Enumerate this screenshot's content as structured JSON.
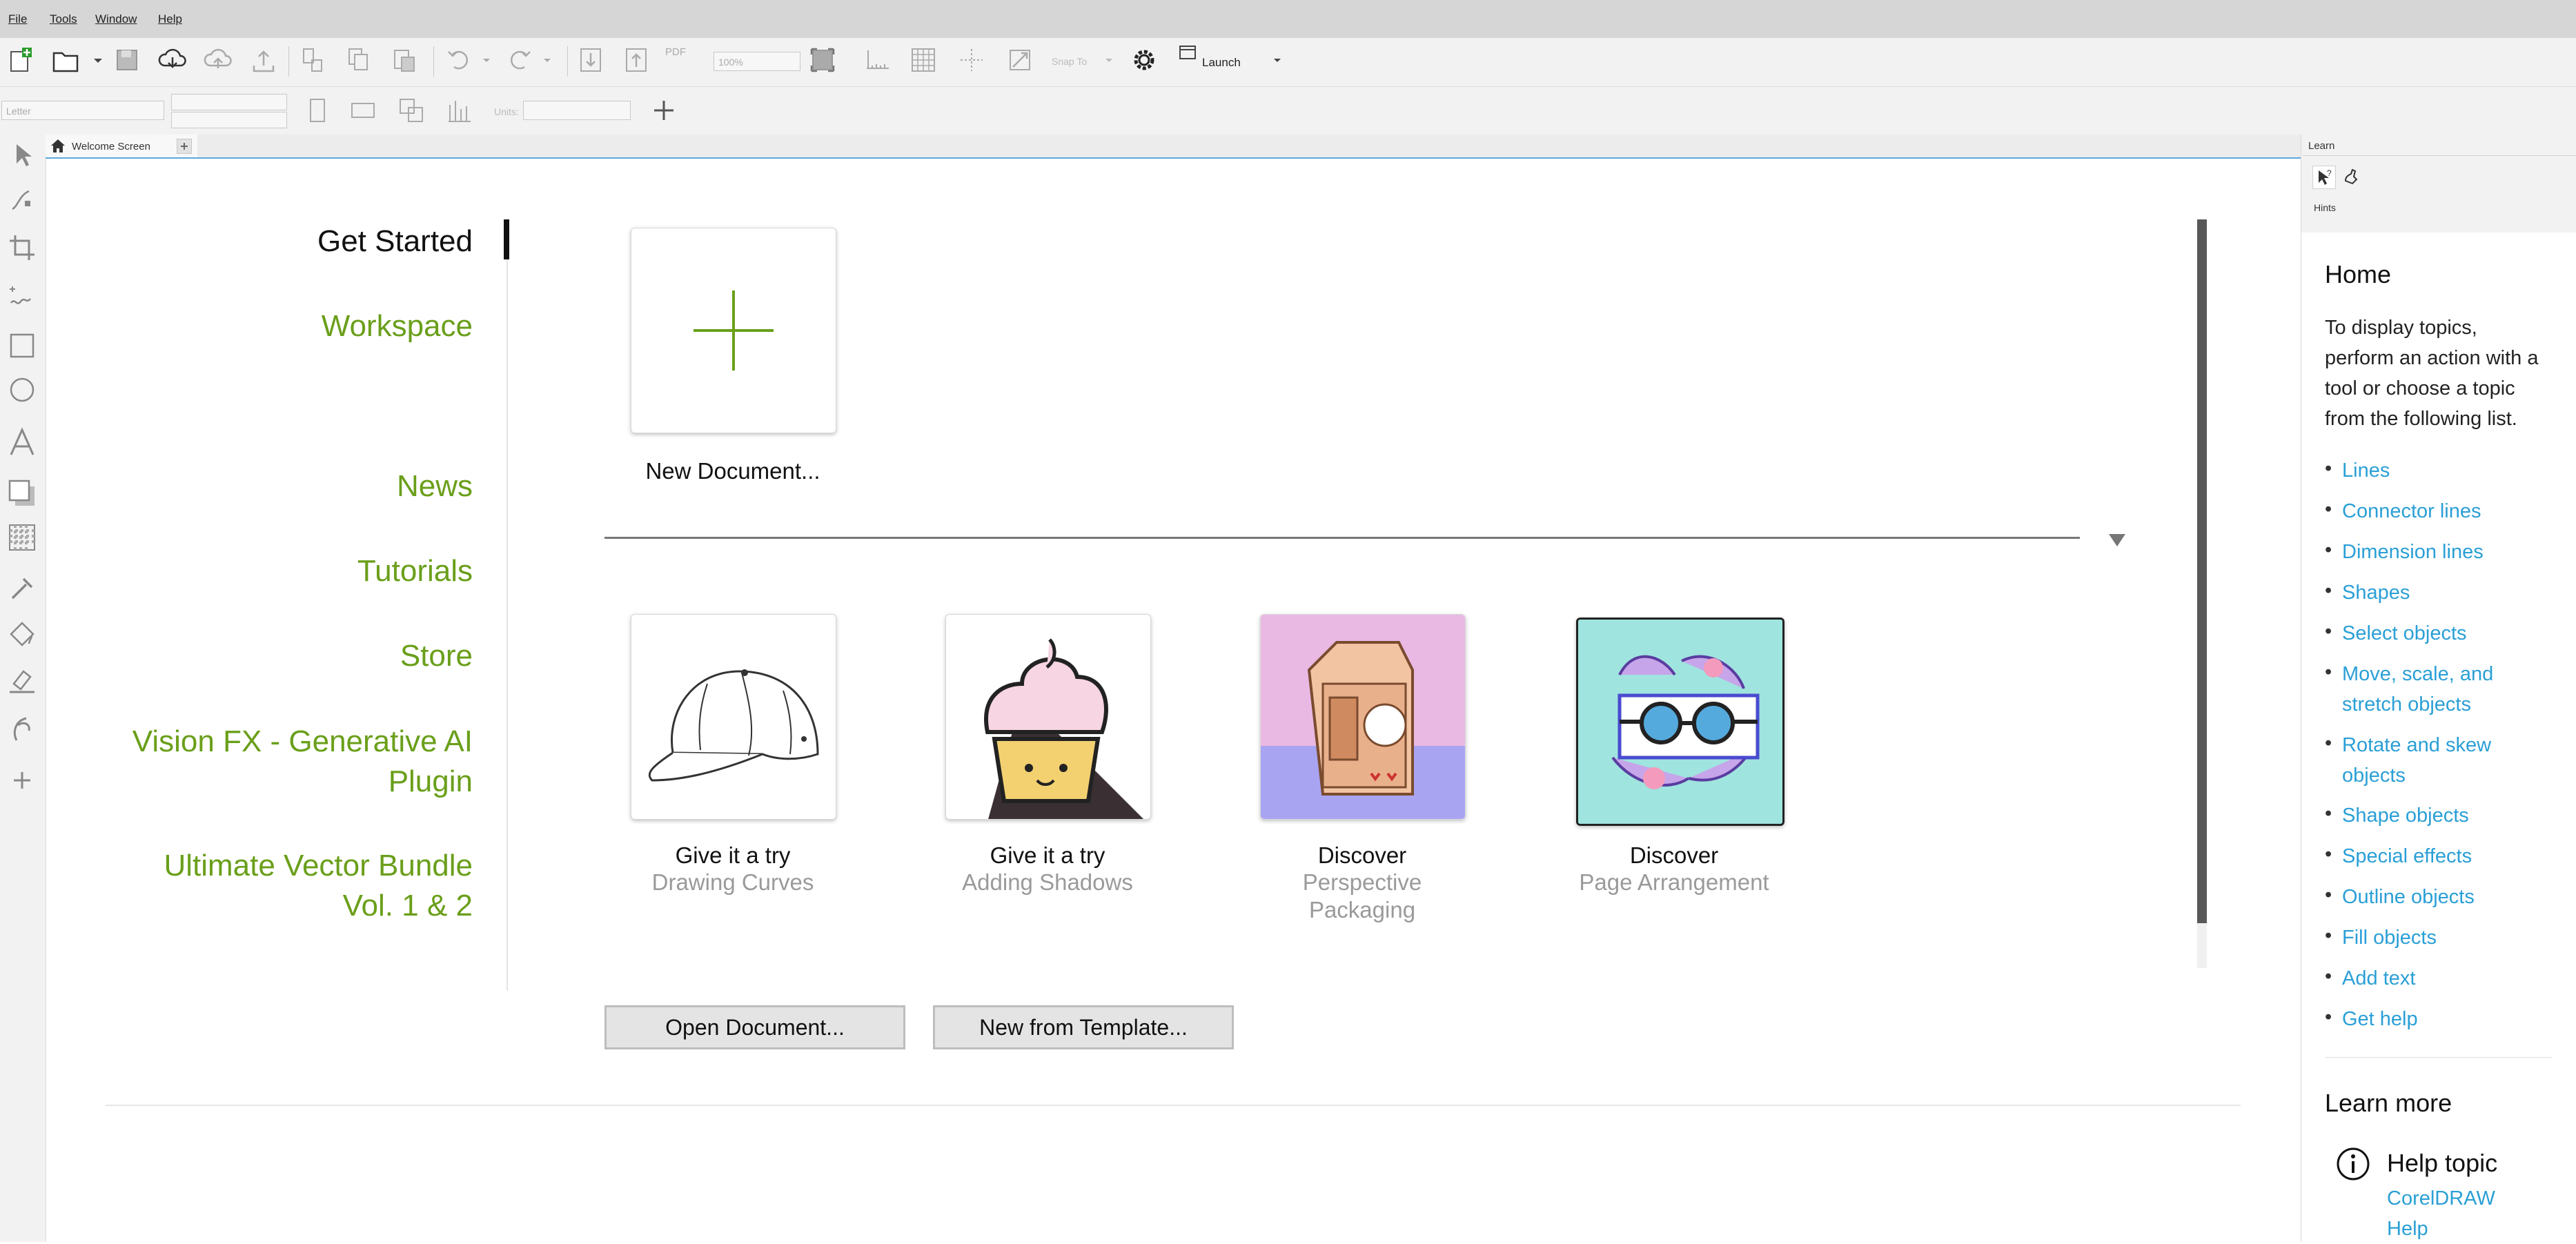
{
  "menubar": {
    "file": "File",
    "tools": "Tools",
    "window": "Window",
    "help": "Help"
  },
  "toolbar": {
    "zoom": "100%",
    "snap": "Snap To",
    "launch": "Launch",
    "pdf": "PDF"
  },
  "propbar": {
    "page_size": "Letter",
    "units": "Units:"
  },
  "tabs": {
    "welcome": "Welcome Screen"
  },
  "nav": {
    "get_started": "Get Started",
    "workspace": "Workspace",
    "news": "News",
    "tutorials": "Tutorials",
    "store": "Store",
    "vision_fx_1": "Vision FX - Generative AI",
    "vision_fx_2": "Plugin",
    "bundle_1": "Ultimate Vector Bundle",
    "bundle_2": "Vol. 1 & 2"
  },
  "new_document": "New Document...",
  "tiles": [
    {
      "title": "Give it a try",
      "subtitle": "Drawing Curves"
    },
    {
      "title": "Give it a try",
      "subtitle": "Adding Shadows"
    },
    {
      "title": "Discover",
      "subtitle_1": "Perspective",
      "subtitle_2": "Packaging"
    },
    {
      "title": "Discover",
      "subtitle": "Page Arrangement"
    }
  ],
  "buttons": {
    "open": "Open Document...",
    "template": "New from Template..."
  },
  "learn": {
    "panel_title": "Learn",
    "hints": "Hints",
    "home": "Home",
    "intro_1": "To display topics,",
    "intro_2": "perform an action with a",
    "intro_3": "tool or choose a topic",
    "intro_4": "from the following list.",
    "topics": [
      "Lines",
      "Connector lines",
      "Dimension lines",
      "Shapes",
      "Select objects",
      "Move, scale, and",
      "stretch objects",
      "Rotate and skew",
      "objects",
      "Shape objects",
      "Special effects",
      "Outline objects",
      "Fill objects",
      "Add text",
      "Get help"
    ],
    "learn_more": "Learn more",
    "help_topic": "Help topic",
    "help_link_1": "CorelDRAW",
    "help_link_2": "Help"
  },
  "colors": {
    "accent_green": "#6a9f1a",
    "link_blue": "#2a9fd6",
    "tab_line": "#5aa8e0"
  }
}
